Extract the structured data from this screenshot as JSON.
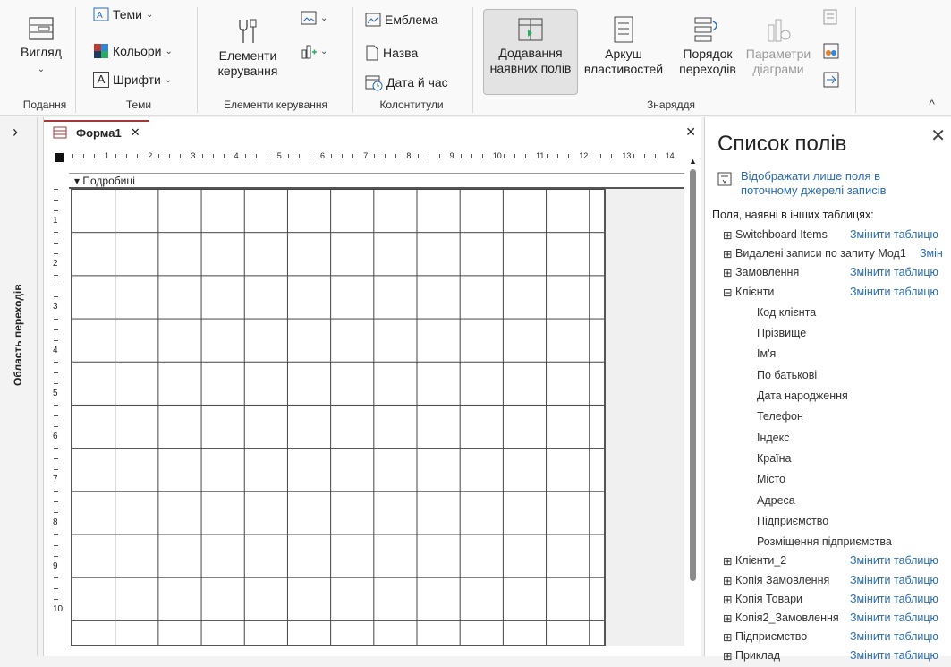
{
  "ribbon": {
    "view": {
      "label": "Вигляд",
      "chev": "⌄"
    },
    "groups": {
      "views": "Подання",
      "themes": "Теми",
      "controls": "Елементи керування",
      "headerfooter": "Колонтитули",
      "tools": "Знаряддя"
    },
    "themes": {
      "themes": "Теми",
      "colors": "Кольори",
      "fonts": "Шрифти"
    },
    "controls": {
      "label_line1": "Елементи",
      "label_line2": "керування"
    },
    "headerfooter": {
      "logo": "Емблема",
      "title": "Назва",
      "datetime": "Дата й час"
    },
    "tools": {
      "add_fields_line1": "Додавання",
      "add_fields_line2": "наявних полів",
      "property_sheet_line1": "Аркуш",
      "property_sheet_line2": "властивостей",
      "tab_order_line1": "Порядок",
      "tab_order_line2": "переходів",
      "chart_settings_line1": "Параметри",
      "chart_settings_line2": "діаграми"
    }
  },
  "nav_pane": {
    "label": "Область переходів",
    "expand": "›"
  },
  "document": {
    "tab_title": "Форма1",
    "tab_close": "✕",
    "section_label": "Подробиці",
    "ruler_h": [
      "1",
      "2",
      "3",
      "4",
      "5",
      "6",
      "7",
      "8",
      "9",
      "10",
      "11",
      "12",
      "13",
      "14"
    ],
    "ruler_v": [
      "1",
      "2",
      "3",
      "4",
      "5",
      "6",
      "7",
      "8",
      "9",
      "10"
    ],
    "close": "✕"
  },
  "field_list": {
    "title": "Список полів",
    "close": "✕",
    "show_only": "Відображати лише поля в поточному джерелі записів",
    "other_tables_label": "Поля, наявні в інших таблицях:",
    "tables_before": [
      {
        "exp": "⊞",
        "name": "Switchboard Items",
        "link": "Змінити таблицю"
      },
      {
        "exp": "⊞",
        "name": "Видалені записи по запиту Мод1",
        "link": "Змін"
      },
      {
        "exp": "⊞",
        "name": "Замовлення",
        "link": "Змінити таблицю"
      },
      {
        "exp": "⊟",
        "name": "Клієнти",
        "link": "Змінити таблицю"
      }
    ],
    "fields": [
      "Код клієнта",
      "Прізвище",
      "Ім'я",
      "По батькові",
      "Дата народження",
      "Телефон",
      "Індекс",
      "Країна",
      "Місто",
      "Адреса",
      "Підприємство",
      "Розміщення підприємства"
    ],
    "tables_after": [
      {
        "exp": "⊞",
        "name": "Клієнти_2",
        "link": "Змінити таблицю"
      },
      {
        "exp": "⊞",
        "name": "Копія Замовлення",
        "link": "Змінити таблицю"
      },
      {
        "exp": "⊞",
        "name": "Копія Товари",
        "link": "Змінити таблицю"
      },
      {
        "exp": "⊞",
        "name": "Копія2_Замовлення",
        "link": "Змінити таблицю"
      },
      {
        "exp": "⊞",
        "name": "Підприємство",
        "link": "Змінити таблицю"
      },
      {
        "exp": "⊞",
        "name": "Приклад",
        "link": "Змінити таблицю"
      }
    ]
  },
  "colors": {
    "accent": "#a4373a",
    "link": "#2b6cb0"
  }
}
